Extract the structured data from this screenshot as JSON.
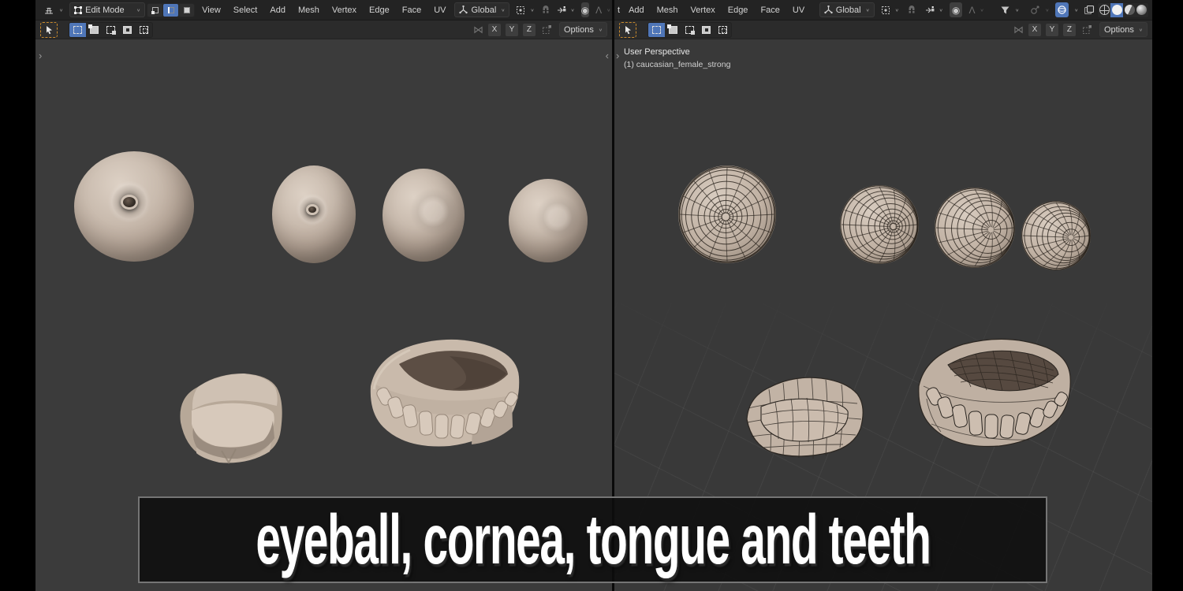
{
  "caption": {
    "text": "eyeball, cornea, tongue and teeth"
  },
  "left_window": {
    "mode": "Edit Mode",
    "menus": [
      "View",
      "Select",
      "Add",
      "Mesh",
      "Vertex",
      "Edge",
      "Face",
      "UV"
    ],
    "orientation": "Global",
    "axes": [
      "X",
      "Y",
      "Z"
    ],
    "options_label": "Options"
  },
  "right_window": {
    "menu_cut": "t",
    "menus": [
      "Add",
      "Mesh",
      "Vertex",
      "Edge",
      "Face",
      "UV"
    ],
    "orientation": "Global",
    "axes": [
      "X",
      "Y",
      "Z"
    ],
    "options_label": "Options",
    "viewport_overlay": {
      "view_label": "User Perspective",
      "object_label": "(1) caucasian_female_strong"
    }
  },
  "icons": {
    "chevron_down": "∨",
    "mirror": "⋈",
    "proportional": "◉",
    "falloff": "Λ",
    "toolbar_expand": "›",
    "sidebar_expand": "‹"
  },
  "colors": {
    "accent_blue": "#4f76b8",
    "tool_active_orange": "#c98a2d",
    "header_bg": "#232323",
    "toolbar_bg": "#2b2b2b",
    "viewport_bg": "#3b3b3b",
    "sphere_base": "#c4b5a8",
    "palate_brown": "#574a40",
    "caption_border": "#757575"
  }
}
